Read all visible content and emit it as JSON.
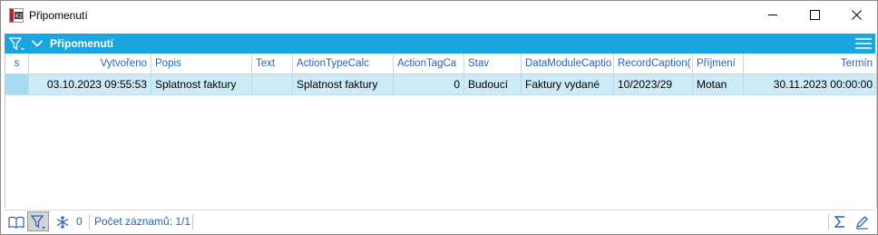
{
  "window": {
    "title": "Připomenutí"
  },
  "panel": {
    "title": "Připomenutí"
  },
  "colors": {
    "accent": "#1ba6e1",
    "header_text": "#2a64b4",
    "row_selected": "#cdeaf7"
  },
  "grid": {
    "columns": [
      "s",
      "Vytvořeno",
      "Popis",
      "Text",
      "ActionTypeCalc",
      "ActionTagCa",
      "Stav",
      "DataModuleCaptio",
      "RecordCaption(",
      "Příjmení",
      "Termín"
    ],
    "rows": [
      [
        "",
        "03.10.2023 09:55:53",
        "Splatnost faktury",
        "",
        "Splatnost faktury",
        "0",
        "Budoucí",
        "Faktury vydané",
        "10/2023/29",
        "Motan",
        "30.11.2023 00:00:00"
      ]
    ]
  },
  "status": {
    "filter_count": "0",
    "records_label": "Počet záznamů: 1/1"
  },
  "icons": [
    "app-icon",
    "minimize-icon",
    "maximize-icon",
    "close-icon",
    "filter-icon",
    "chevron-down-icon",
    "hamburger-menu-icon",
    "book-icon",
    "filter-icon",
    "snowflake-icon",
    "sigma-icon",
    "pencil-icon"
  ]
}
